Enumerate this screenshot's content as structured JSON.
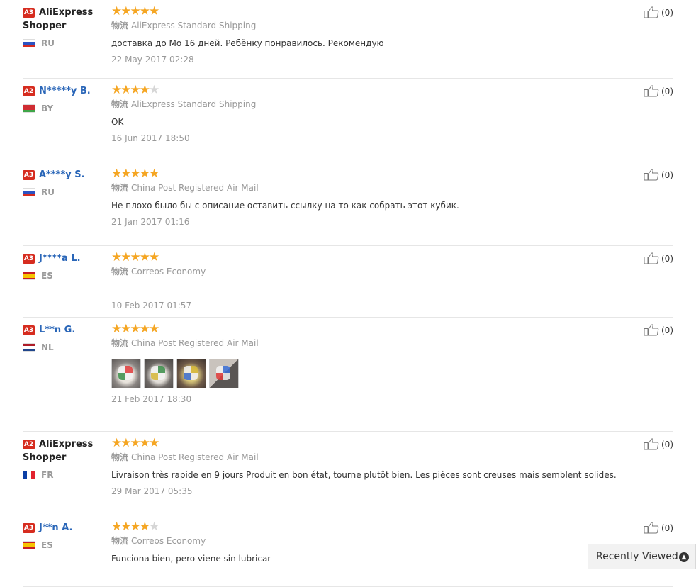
{
  "reviews": [
    {
      "level": "A3",
      "name": "AliExpress Shopper",
      "country": "RU",
      "rating": 5,
      "shipping": "AliExpress Standard Shipping",
      "text": "доставка до Мо 16 дней. Ребёнку понравилось. Рекомендую",
      "date": "22 May 2017 02:28",
      "helpful": "(0)"
    },
    {
      "level": "A2",
      "name": "N*****y B.",
      "country": "BY",
      "rating": 4,
      "shipping": "AliExpress Standard Shipping",
      "text": "OK",
      "date": "16 Jun 2017 18:50",
      "helpful": "(0)"
    },
    {
      "level": "A3",
      "name": "A****y S.",
      "country": "RU",
      "rating": 5,
      "shipping": "China Post Registered Air Mail",
      "text": "Не плохо было бы с описание оставить ссылку на то как собрать этот кубик.",
      "date": "21 Jan 2017 01:16",
      "helpful": "(0)"
    },
    {
      "level": "A3",
      "name": "J****a L.",
      "country": "ES",
      "rating": 5,
      "shipping": "Correos Economy",
      "text": "",
      "date": "10 Feb 2017 01:57",
      "helpful": "(0)"
    },
    {
      "level": "A3",
      "name": "L**n G.",
      "country": "NL",
      "rating": 5,
      "shipping": "China Post Registered Air Mail",
      "text": "",
      "date": "21 Feb 2017 18:30",
      "helpful": "(0)",
      "photos": 4
    },
    {
      "level": "A2",
      "name": "AliExpress Shopper",
      "country": "FR",
      "rating": 5,
      "shipping": "China Post Registered Air Mail",
      "text": "Livraison très rapide en 9 jours Produit en bon état, tourne plutôt bien. Les pièces sont creuses mais semblent solides.",
      "date": "29 Mar 2017 05:35",
      "helpful": "(0)"
    },
    {
      "level": "A3",
      "name": "J**n A.",
      "country": "ES",
      "rating": 4,
      "shipping": "Correos Economy",
      "text": "Funciona bien, pero viene sin lubricar",
      "date": "",
      "helpful": "(0)"
    }
  ],
  "shipping_icon_text": "物流",
  "recently_viewed": "Recently Viewed",
  "colors": {
    "star": "#f5a623",
    "level_badge": "#d62c1f",
    "masked_name": "#2a66b8"
  }
}
